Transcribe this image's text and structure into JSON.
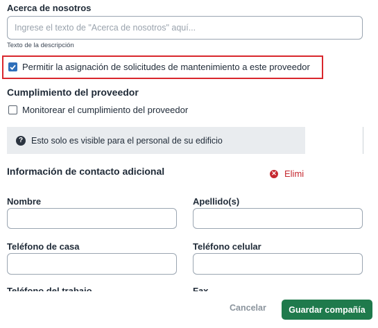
{
  "about": {
    "label": "Acerca de nosotros",
    "placeholder": "Ingrese el texto de \"Acerca de nosotros\" aquí...",
    "help": "Texto de la descripción"
  },
  "allow_maintenance": {
    "label": "Permitir la asignación de solicitudes de mantenimiento a este proveedor",
    "checked": true
  },
  "compliance": {
    "title": "Cumplimiento del proveedor",
    "monitor_label": "Monitorear el cumplimiento del proveedor",
    "checked": false
  },
  "notice": {
    "icon": "question-circle-icon",
    "text": "Esto solo es visible para el personal de su edificio"
  },
  "contact": {
    "title": "Información de contacto adicional",
    "delete_label": "Elimi",
    "fields": {
      "first_name": "Nombre",
      "last_name": "Apellido(s)",
      "home_phone": "Teléfono de casa",
      "cell_phone": "Teléfono celular",
      "work_phone": "Teléfono del trabajo",
      "fax": "Fax"
    }
  },
  "footer": {
    "cancel": "Cancelar",
    "save": "Guardar compañía"
  },
  "colors": {
    "primary": "#1f7a4c",
    "checkbox": "#2f6fba",
    "highlight": "#d9262c",
    "danger": "#c5282f"
  }
}
